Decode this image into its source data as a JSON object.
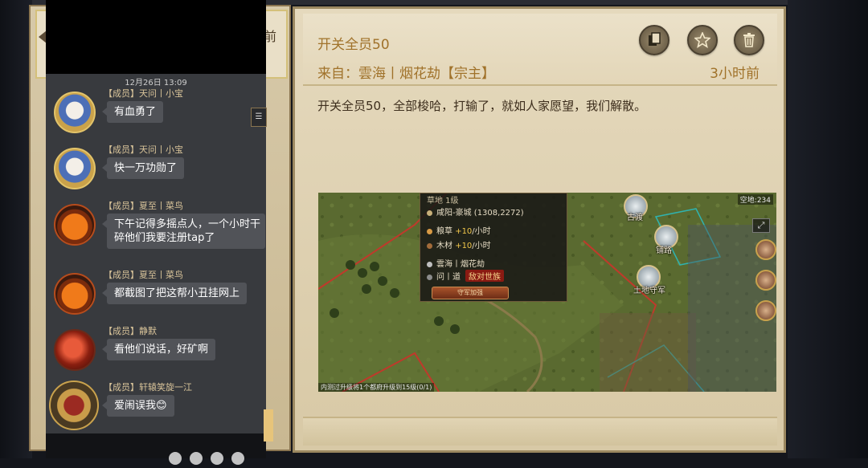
{
  "left_panel": {
    "partial_text": "前"
  },
  "mail": {
    "title": "开关全员50",
    "from": "来自：雲海丨烟花劫【宗主】",
    "time": "3小时前",
    "body": "开关全员50，全部梭哈，打输了，就如人家愿望，我们解散。",
    "buttons": [
      "copy-icon",
      "star-icon",
      "trash-icon"
    ]
  },
  "screenshot": {
    "top_partial": "草地 1级",
    "location": "咸阳-豪城 (1308,2272)",
    "food": {
      "name": "粮草",
      "rate": "+10",
      "unit": "/小时"
    },
    "wood": {
      "name": "木材",
      "rate": "+10",
      "unit": "/小时"
    },
    "owner": "雲海丨烟花劫",
    "alliance_name": "问丨道",
    "hostile_tag": "敌对世族",
    "defend_button": "守军加强",
    "labels": {
      "ancient_ford": "古渡",
      "bridge": "铺路",
      "local_guard": "土地守军"
    },
    "space": "空地:234",
    "bottom_tip": "内测过升级将1个都府升级到15级(0/1)",
    "colors": {
      "territory_border": "#c0392b",
      "teal_border": "#2fb3b0"
    }
  },
  "chat": {
    "date": "12月26日 13:09",
    "messages": [
      {
        "member": "【成员】天问丨小宝",
        "text": "有血勇了",
        "avatar": "blue"
      },
      {
        "member": "【成员】天问丨小宝",
        "text": "快一万功勋了",
        "avatar": "blue"
      },
      {
        "member": "【成员】夏至丨菜鸟",
        "text": "下午记得多摇点人，一个小时干",
        "text2": "碎他们我要注册tap了",
        "avatar": "pumpkin"
      },
      {
        "member": "【成员】夏至丨菜鸟",
        "text": "都截图了把这帮小丑挂网上",
        "avatar": "pumpkin"
      },
      {
        "member": "【成员】静默",
        "text": "看他们说话，好矿啊",
        "avatar": "red"
      },
      {
        "member": "【成员】轩辕笑旋一江",
        "text": "爱闹误我😊",
        "avatar": "warrior"
      }
    ]
  }
}
